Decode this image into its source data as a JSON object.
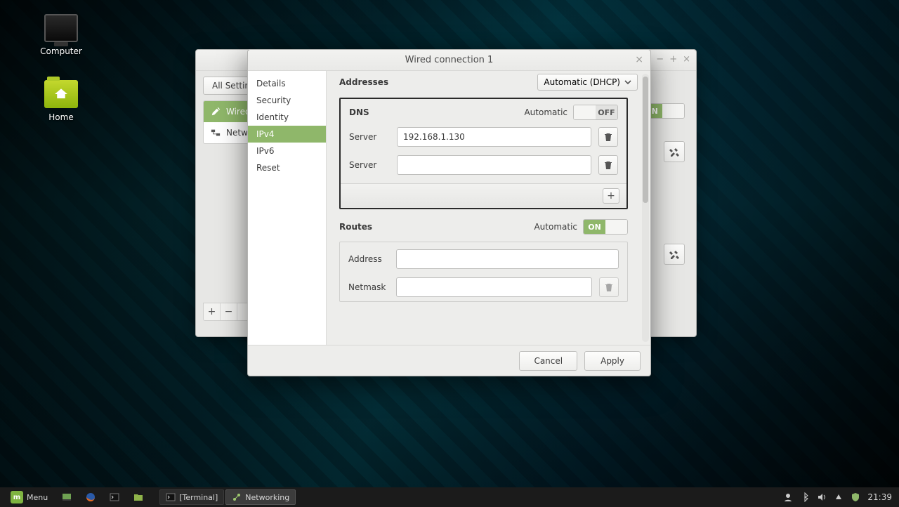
{
  "desktop": {
    "icons": {
      "computer": "Computer",
      "home": "Home"
    }
  },
  "back_window": {
    "all_settings": "All Settings",
    "sidebar": {
      "wired": "Wired",
      "network_proxy": "Network proxy"
    },
    "toggle_on": "ON",
    "footer": {
      "plus": "+",
      "minus": "−"
    }
  },
  "dialog": {
    "title": "Wired connection 1",
    "side": {
      "details": "Details",
      "security": "Security",
      "identity": "Identity",
      "ipv4": "IPv4",
      "ipv6": "IPv6",
      "reset": "Reset"
    },
    "addresses_label": "Addresses",
    "addresses_mode": "Automatic (DHCP)",
    "dns": {
      "label": "DNS",
      "auto_label": "Automatic",
      "toggle": "OFF",
      "field_label": "Server",
      "server1": "192.168.1.130",
      "server2": ""
    },
    "routes": {
      "label": "Routes",
      "auto_label": "Automatic",
      "toggle": "ON",
      "address_label": "Address",
      "netmask_label": "Netmask"
    },
    "cancel": "Cancel",
    "apply": "Apply"
  },
  "taskbar": {
    "menu": "Menu",
    "terminal": "[Terminal]",
    "networking": "Networking",
    "clock": "21:39"
  }
}
